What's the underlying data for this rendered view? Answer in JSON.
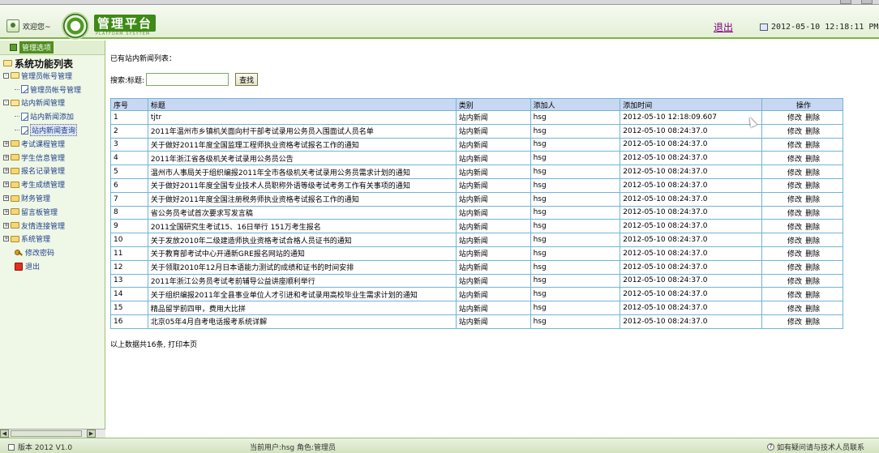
{
  "header": {
    "welcome": "欢迎您~",
    "logo_title": "管理平台",
    "logo_sub": "PLATFORM SYSYTEM",
    "logout": "退出",
    "datetime": "2012-05-10 12:18:11 PM"
  },
  "sidebar": {
    "head_label": "管理选项",
    "root": "系统功能列表",
    "groups": [
      {
        "label": "管理员帐号管理",
        "expanded": true,
        "children": [
          "管理员帐号管理"
        ]
      },
      {
        "label": "站内新闻管理",
        "expanded": true,
        "children": [
          "站内新闻添加",
          "站内新闻查询"
        ]
      },
      {
        "label": "考试课程管理",
        "expanded": false
      },
      {
        "label": "学生信息管理",
        "expanded": false
      },
      {
        "label": "报名记录管理",
        "expanded": false
      },
      {
        "label": "考生成绩管理",
        "expanded": false
      },
      {
        "label": "财务管理",
        "expanded": false
      },
      {
        "label": "留言板管理",
        "expanded": false
      },
      {
        "label": "友情连接管理",
        "expanded": false
      },
      {
        "label": "系统管理",
        "expanded": false
      }
    ],
    "change_password": "修改密码",
    "exit": "退出"
  },
  "main": {
    "list_title": "已有站内新闻列表：",
    "search_label": "搜索:标题:",
    "search_value": "",
    "search_button": "查找",
    "columns": [
      "序号",
      "标题",
      "类别",
      "添加人",
      "添加时间",
      "操作"
    ],
    "edit_label": "修改",
    "delete_label": "删除",
    "rows": [
      [
        "1",
        "tjtr",
        "站内新闻",
        "hsg",
        "2012-05-10 12:18:09.607"
      ],
      [
        "2",
        "2011年温州市乡镇机关面向村干部考试录用公务员入围面试人员名单",
        "站内新闻",
        "hsg",
        "2012-05-10 08:24:37.0"
      ],
      [
        "3",
        "关于做好2011年度全国监理工程师执业资格考试报名工作的通知",
        "站内新闻",
        "hsg",
        "2012-05-10 08:24:37.0"
      ],
      [
        "4",
        "2011年浙江省各级机关考试录用公务员公告",
        "站内新闻",
        "hsg",
        "2012-05-10 08:24:37.0"
      ],
      [
        "5",
        "温州市人事局关于组织编报2011年全市各级机关考试录用公务员需求计划的通知",
        "站内新闻",
        "hsg",
        "2012-05-10 08:24:37.0"
      ],
      [
        "6",
        "关于做好2011年度全国专业技术人员职称外语等级考试考务工作有关事项的通知",
        "站内新闻",
        "hsg",
        "2012-05-10 08:24:37.0"
      ],
      [
        "7",
        "关于做好2011年度全国注册税务师执业资格考试报名工作的通知",
        "站内新闻",
        "hsg",
        "2012-05-10 08:24:37.0"
      ],
      [
        "8",
        "省公务员考试首次要求写发言稿",
        "站内新闻",
        "hsg",
        "2012-05-10 08:24:37.0"
      ],
      [
        "9",
        "2011全国研究生考试15、16日举行 151万考生报名",
        "站内新闻",
        "hsg",
        "2012-05-10 08:24:37.0"
      ],
      [
        "10",
        "关于发放2010年二级建造师执业资格考试合格人员证书的通知",
        "站内新闻",
        "hsg",
        "2012-05-10 08:24:37.0"
      ],
      [
        "11",
        "关于教育部考试中心开通新GRE报名网站的通知",
        "站内新闻",
        "hsg",
        "2012-05-10 08:24:37.0"
      ],
      [
        "12",
        "关于领取2010年12月日本语能力测试的成绩和证书的时间安排",
        "站内新闻",
        "hsg",
        "2012-05-10 08:24:37.0"
      ],
      [
        "13",
        "2011年浙江公务员考试考前辅导公益讲座顺利举行",
        "站内新闻",
        "hsg",
        "2012-05-10 08:24:37.0"
      ],
      [
        "14",
        "关于组织编报2011年全县事业单位人才引进和考试录用高校毕业生需求计划的通知",
        "站内新闻",
        "hsg",
        "2012-05-10 08:24:37.0"
      ],
      [
        "15",
        "精品留学前四甲，费用大比拼",
        "站内新闻",
        "hsg",
        "2012-05-10 08:24:37.0"
      ],
      [
        "16",
        "北京05年4月自考电话报考系统详解",
        "站内新闻",
        "hsg",
        "2012-05-10 08:24:37.0"
      ]
    ],
    "summary": "以上数据共16条, 打印本页"
  },
  "footer": {
    "version": "版本 2012 V1.0",
    "current_user": "当前用户:hsg  角色:管理员",
    "help": "如有疑问请与技术人员联系"
  }
}
